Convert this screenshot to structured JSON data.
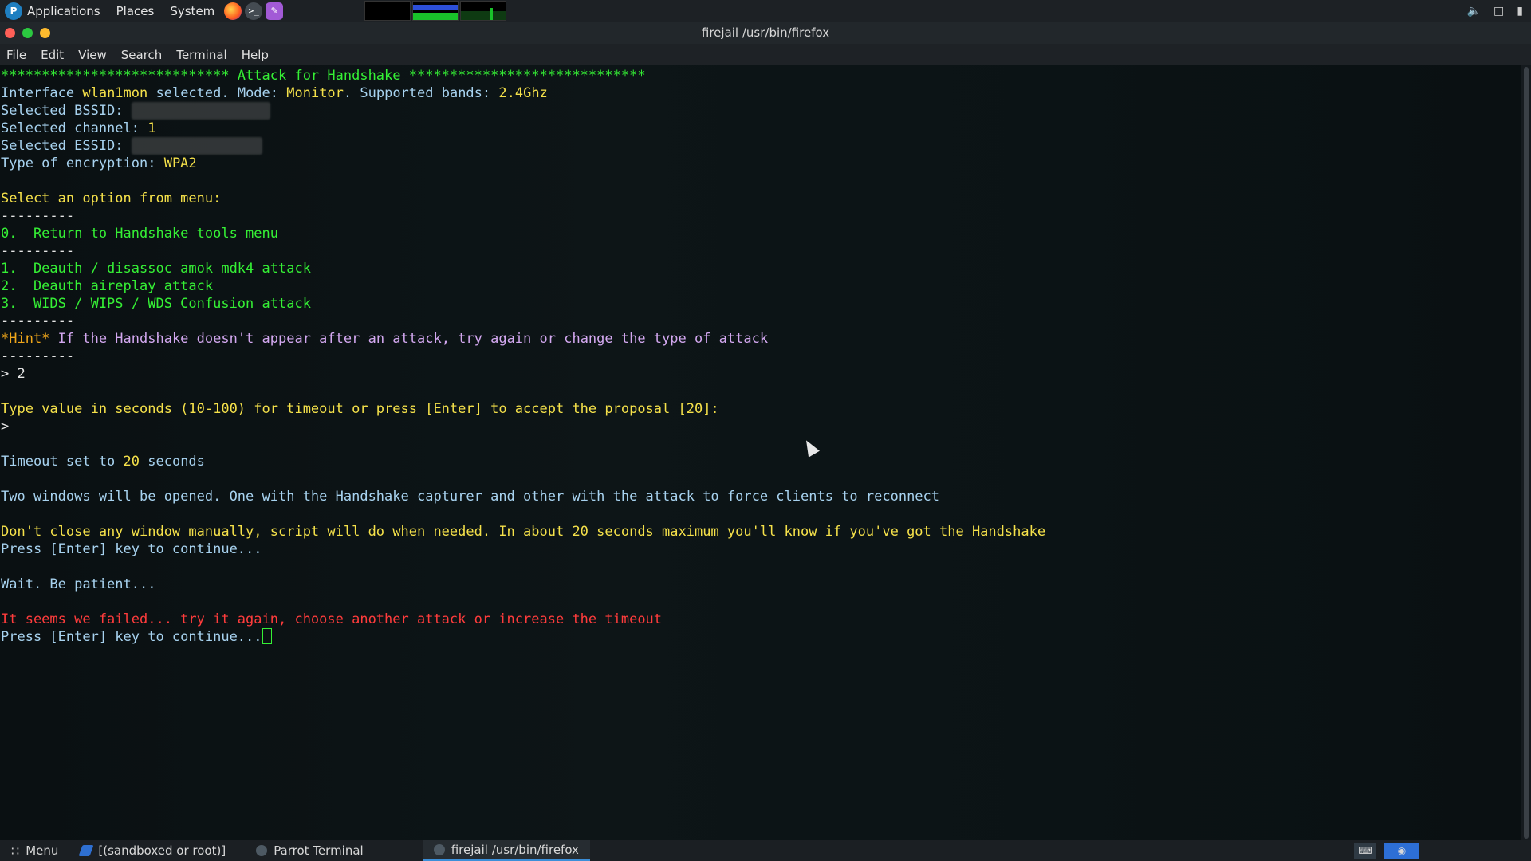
{
  "top_panel": {
    "applications": "Applications",
    "places": "Places",
    "system": "System"
  },
  "window": {
    "title": "firejail /usr/bin/firefox",
    "menu": [
      "File",
      "Edit",
      "View",
      "Search",
      "Terminal",
      "Help"
    ]
  },
  "terminal": {
    "header": "**************************** Attack for Handshake *****************************",
    "interface_line_prefix": "Interface ",
    "interface_name": "wlan1mon",
    "interface_line_mid": " selected. Mode: ",
    "mode": "Monitor",
    "interface_line_suffix": ". Supported bands: ",
    "bands": "2.4Ghz",
    "bssid_label": "Selected BSSID: ",
    "channel_label": "Selected channel: ",
    "channel_value": "1",
    "essid_label": "Selected ESSID: ",
    "encryption_label": "Type of encryption: ",
    "encryption_value": "WPA2",
    "menu_prompt": "Select an option from menu:",
    "separator": "---------",
    "option_0": "0.  Return to Handshake tools menu",
    "option_1": "1.  Deauth / disassoc amok mdk4 attack",
    "option_2": "2.  Deauth aireplay attack",
    "option_3": "3.  WIDS / WIPS / WDS Confusion attack",
    "hint_tag": "*Hint*",
    "hint_text": " If the Handshake doesn't appear after an attack, try again or change the type of attack",
    "choice": "> 2",
    "timeout_prompt": "Type value in seconds (10-100) for timeout or press [Enter] to accept the proposal [20]:",
    "prompt_symbol": ">",
    "timeout_set_prefix": "Timeout set to ",
    "timeout_set_value": "20",
    "timeout_set_suffix": " seconds",
    "two_windows": "Two windows will be opened. One with the Handshake capturer and other with the attack to force clients to reconnect",
    "dont_close": "Don't close any window manually, script will do when needed. In about 20 seconds maximum you'll know if you've got the Handshake",
    "press_enter": "Press [Enter] key to continue...",
    "wait": "Wait. Be patient...",
    "failed": "It seems we failed... try it again, choose another attack or increase the timeout",
    "press_enter_2": "Press [Enter] key to continue..."
  },
  "taskbar": {
    "menu": "Menu",
    "tasks": [
      "[(sandboxed or root)]",
      "Parrot Terminal",
      "firejail /usr/bin/firefox"
    ]
  }
}
